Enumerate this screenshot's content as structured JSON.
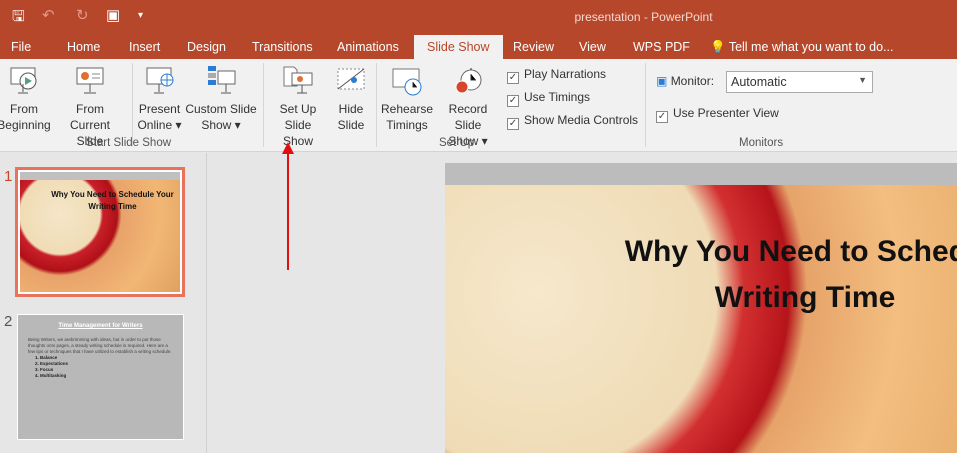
{
  "window": {
    "title": "presentation - PowerPoint"
  },
  "tabs": [
    "File",
    "Home",
    "Insert",
    "Design",
    "Transitions",
    "Animations",
    "Slide Show",
    "Review",
    "View",
    "WPS PDF"
  ],
  "tell_me": "Tell me what you want to do...",
  "ribbon": {
    "from_beginning": [
      "From",
      "Beginning"
    ],
    "from_current": [
      "From",
      "Current Slide"
    ],
    "present_online": [
      "Present",
      "Online ▾"
    ],
    "custom_show": [
      "Custom Slide",
      "Show ▾"
    ],
    "setup_show": [
      "Set Up",
      "Slide Show"
    ],
    "hide_slide": [
      "Hide",
      "Slide"
    ],
    "rehearse": [
      "Rehearse",
      "Timings"
    ],
    "record": [
      "Record Slide",
      "Show ▾"
    ],
    "play_narrations": "Play Narrations",
    "use_timings": "Use Timings",
    "show_media": "Show Media Controls",
    "monitor_label": "Monitor:",
    "monitor_value": "Automatic",
    "presenter_view": "Use Presenter View",
    "groups": {
      "start": "Start Slide Show",
      "setup": "Set Up",
      "monitors": "Monitors"
    }
  },
  "slides": [
    {
      "number": "1",
      "title": "Why You Need to Schedule Your Writing Time"
    },
    {
      "number": "2",
      "title": "Time Management for Writers",
      "body": "Being Writers, we arebrimming with ideas, but in order to put those thoughts onto pages, a steady writing schedule is required. Here are a few tips or techniques that I have utilized to establish a writing schedule.",
      "items": [
        "Balance",
        "Expectations",
        "Focus",
        "Multitasking"
      ]
    }
  ],
  "main_slide": {
    "title_line1": "Why You Need to Schedu",
    "title_line2": "Writing Time"
  }
}
